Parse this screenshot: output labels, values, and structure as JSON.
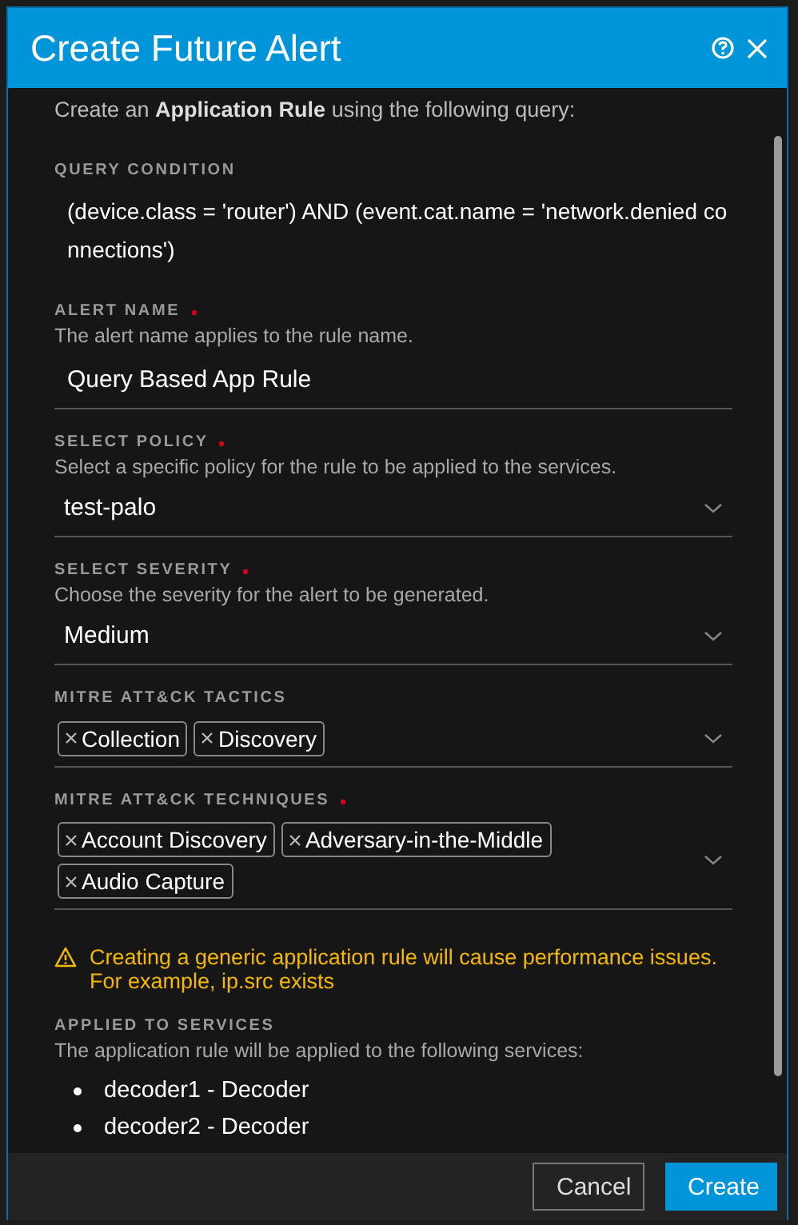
{
  "dialog": {
    "title": "Create Future Alert",
    "intro": "Create an **Application Rule** using the following query:"
  },
  "query": {
    "label": "QUERY CONDITION",
    "text": "(device.class = 'router') AND (event.cat.name = 'network.denied connections')"
  },
  "fields": [
    {
      "kind": "text",
      "label": "ALERT NAME",
      "required": true,
      "hint": "The alert name applies to the rule name.",
      "value": "Query Based App Rule"
    },
    {
      "kind": "select",
      "label": "SELECT POLICY",
      "required": true,
      "hint": "Select a specific policy for the rule to be applied to the services.",
      "value": "test-palo"
    },
    {
      "kind": "select",
      "label": "SELECT SEVERITY",
      "required": true,
      "hint": "Choose the severity for the alert to be generated.",
      "value": "Medium"
    },
    {
      "kind": "tags",
      "label": "MITRE ATT&CK TACTICS",
      "required": false,
      "tags": [
        "Collection",
        "Discovery"
      ]
    },
    {
      "kind": "tags",
      "label": "MITRE ATT&CK TECHNIQUES",
      "required": true,
      "tags": [
        "Account Discovery",
        "Adversary-in-the-Middle",
        "Audio Capture"
      ]
    }
  ],
  "warning": "Creating a generic application rule will cause performance issues. For example, ip.src exists",
  "services": {
    "label": "APPLIED TO SERVICES",
    "hint": "The application rule will be applied to the following services:",
    "items": [
      "decoder1 - Decoder",
      "decoder2 - Decoder"
    ]
  },
  "buttons": [
    {
      "label": "Cancel",
      "kind": "secondary"
    },
    {
      "label": "Create",
      "kind": "primary"
    }
  ]
}
